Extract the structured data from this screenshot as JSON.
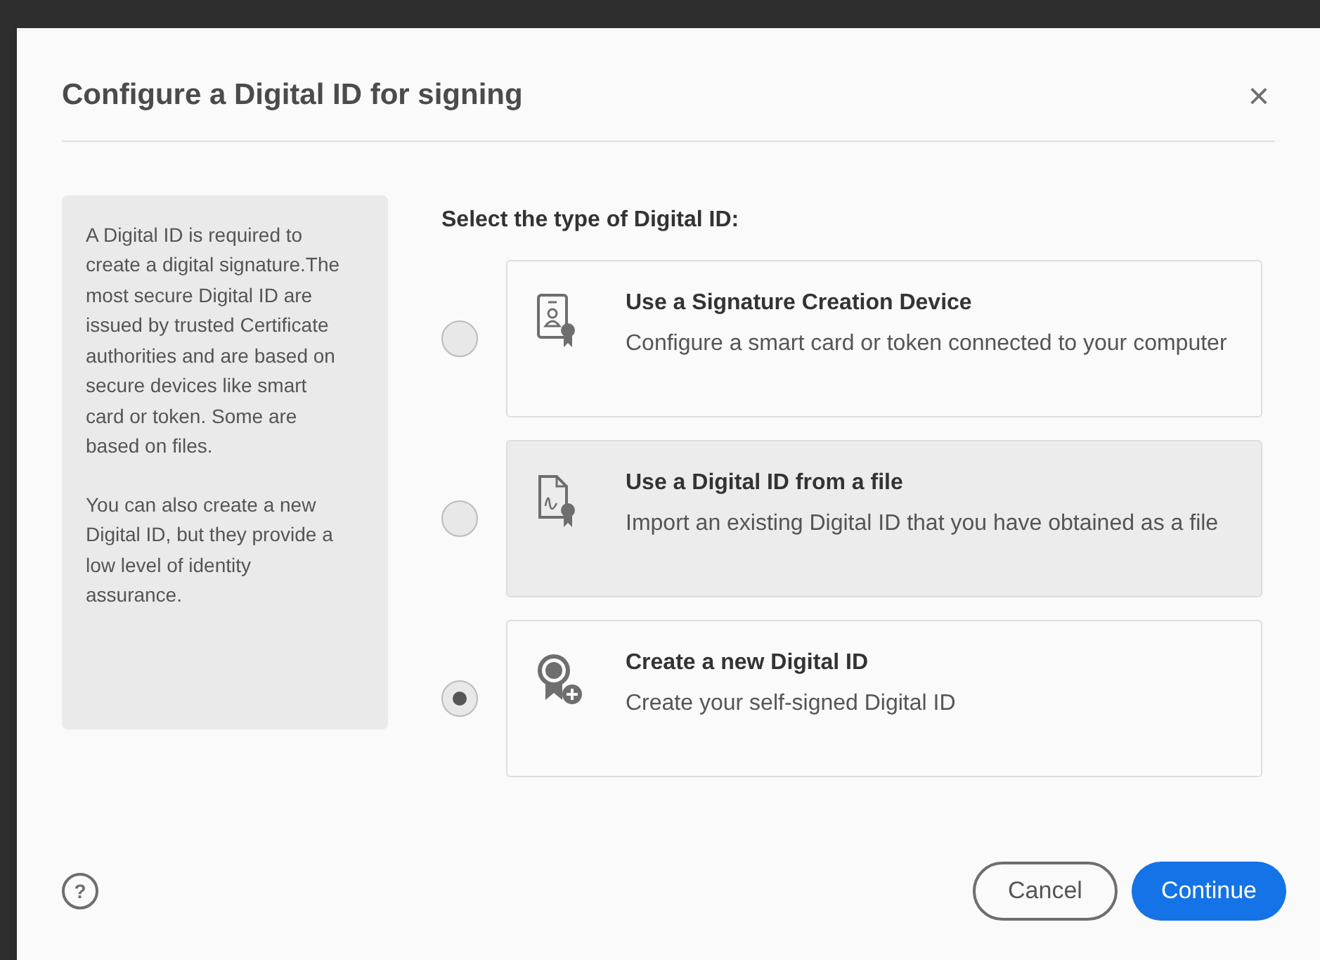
{
  "dialog": {
    "title": "Configure a Digital ID for signing",
    "close": "×"
  },
  "info": {
    "paragraphs": [
      "A Digital ID is required to create a digital signature.The most secure Digital ID are issued by trusted Certificate authorities and are based on secure devices like smart card or token. Some are based on files.",
      "You can also create a new Digital ID, but they provide a low level of identity assurance."
    ]
  },
  "prompt": "Select the type of Digital ID:",
  "options": [
    {
      "kind": "device",
      "title": "Use a Signature Creation Device",
      "description": "Configure a smart card or token connected to your computer",
      "selected": false,
      "highlighted": false
    },
    {
      "kind": "file",
      "title": "Use a Digital ID from a file",
      "description": "Import an existing Digital ID that you have obtained as a file",
      "selected": false,
      "highlighted": true
    },
    {
      "kind": "new",
      "title": "Create a new Digital ID",
      "description": "Create your self-signed Digital ID",
      "selected": true,
      "highlighted": false
    }
  ],
  "footer": {
    "help": "?",
    "buttons": [
      {
        "kind": "secondary",
        "label": "Cancel"
      },
      {
        "kind": "primary",
        "label": "Continue"
      }
    ]
  }
}
